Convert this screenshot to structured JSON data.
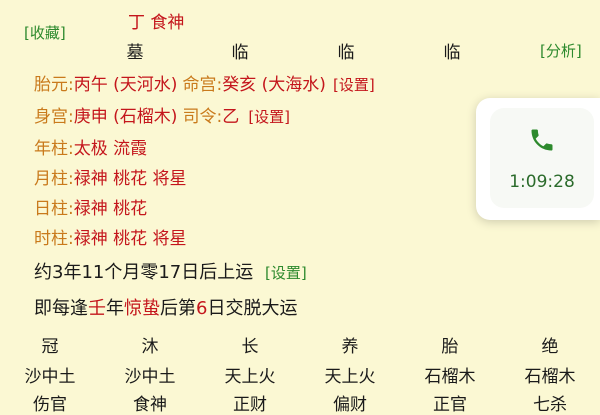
{
  "toolbar": {
    "favorite": "[收藏]",
    "analyze": "[分析]"
  },
  "top": {
    "star": "丁 食神",
    "stages": [
      "墓",
      "临",
      "临",
      "临"
    ]
  },
  "pillars": {
    "taiyuan_label": "胎元:",
    "taiyuan_value": "丙午 (天河水)",
    "minggong_label": "命宫:",
    "minggong_value": "癸亥 (大海水)",
    "set1": "[设置]",
    "shengong_label": "身宫:",
    "shengong_value": "庚申 (石榴木)",
    "siling_label": "司令:",
    "siling_value": "乙",
    "set2": "[设置]",
    "year_label": "年柱:",
    "year_value": "太极 流霞",
    "month_label": "月柱:",
    "month_value": "禄神 桃花 将星",
    "day_label": "日柱:",
    "day_value": "禄神 桃花",
    "hour_label": "时柱:",
    "hour_value": "禄神 桃花 将星"
  },
  "luck": {
    "start_text": "约3年11个月零17日后上运",
    "set3": "[设置]",
    "rule_prefix": "即每逢",
    "rule_stem": "壬",
    "rule_mid1": "年",
    "rule_term": "惊蛰",
    "rule_mid2": "后第",
    "rule_day": "6",
    "rule_suffix": "日交脱大运"
  },
  "table": {
    "stages": [
      "冠",
      "沐",
      "长",
      "养",
      "胎",
      "绝"
    ],
    "nayin": [
      "沙中土",
      "沙中土",
      "天上火",
      "天上火",
      "石榴木",
      "石榴木"
    ],
    "gods": [
      "伤官",
      "食神",
      "正财",
      "偏财",
      "正官",
      "七杀"
    ]
  },
  "call": {
    "duration": "1:09:28",
    "icon": "phone-icon"
  },
  "colors": {
    "background": "#fbf8d3",
    "red": "#c4161c",
    "green": "#2d8a2d",
    "orange": "#c97a1c"
  }
}
